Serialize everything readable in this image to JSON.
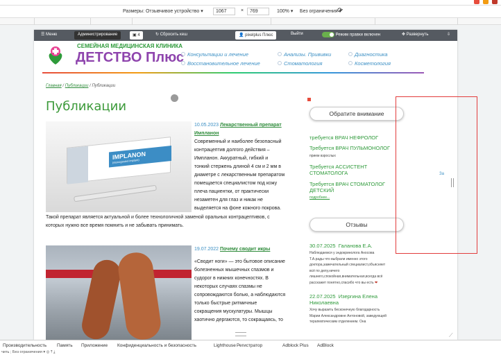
{
  "devtools_bar": {
    "dimensions_label": "Размеры: Отзывчивое устройство ▾",
    "width": "1067",
    "times": "×",
    "height": "769",
    "zoom": "100% ▾",
    "throttling": "Без ограничения ▾"
  },
  "admin_bar": {
    "menu": "Меню",
    "admin": "Администрирование",
    "badge": "4",
    "reset_cache": "Сбросить кеш",
    "user": "pixelplus Плюс",
    "logout": "Выйти",
    "edit_mode": "Режим правки включен",
    "expand": "Развернуть"
  },
  "site": {
    "logo_line1": "СЕМЕЙНАЯ МЕДИЦИНСКАЯ КЛИНИКА",
    "logo_line2": "ДЕТСТВО Плюс",
    "nav": [
      "Консультации и лечение",
      "Анализы. Прививки",
      "Диагностика",
      "Восстановительное лечение",
      "Стоматология",
      "Косметология"
    ]
  },
  "breadcrumb": {
    "home": "Главная",
    "sep1": " / ",
    "section": "Публикации",
    "sep2": " / ",
    "current": "Публикации"
  },
  "page_title": "Публикации",
  "publications": [
    {
      "date": "10.05.2023",
      "title_a": "Лекарственный препарат",
      "title_b": "Импланон",
      "lines": [
        "Современный и наиболее безопасный",
        "контрацептив долгого действия –",
        "Импланон. Аккуратный, гибкий и",
        "тонкий стержень длиной 4 см и 2 мм в",
        "диаметре с лекарственным препаратом",
        "помещается специалистом под кожу",
        "плеча пациентки, от практически",
        "незаметен для глаз и никак не",
        "выделяется на фоне кожного покрова."
      ],
      "tail1": "Такой препарат является актуальной и более технологичной заменой оральных контрацептивов, с",
      "tail2": "которых нужно все время помнить и не забывать принимать.",
      "image_label": "IMPLANON",
      "image_sub": "(etonogestrel implant)"
    },
    {
      "date": "19.07.2022",
      "title": "Почему сводит икры",
      "lines": [
        "«Сводит ноги» — это бытовое описание",
        "болезненных мышечных спазмов и",
        "судорог в нижних конечностях. В",
        "некоторых случаях спазмы не",
        "сопровождаются болью, а наблюдаются",
        "только быстрые ритмичные",
        "сокращения мускулатуры. Мышцы",
        "хаотично дергаются, то сокращаясь, то"
      ]
    }
  ],
  "sidebar": {
    "attention_button": "Обратите внимание",
    "vacancies": [
      {
        "text": "требуется ВРАЧ НЕФРОЛОГ"
      },
      {
        "text": "Требуется ВРАЧ ПУЛЬМОНОЛОГ",
        "sub": "прием взрослых"
      },
      {
        "text": "Требуется АССИСТЕНТ",
        "text2": "СТОМАТОЛОГА"
      },
      {
        "text": "Требуется ВРАЧ СТОМАТОЛОГ",
        "text2": "ДЕТСКИЙ",
        "more": "подробнее..."
      }
    ],
    "reviews_button": "Отзывы",
    "reviews": [
      {
        "date": "30.07.2025",
        "author": "Галанова Е.А.",
        "lines": [
          "Наблюдаемся у эндокринолога Аносова",
          "Т.А.рады что выбрали именно этого",
          "доктора,замечательный специалист,объясняет",
          "всё по делу,ничего",
          "лишнего,спокойная,внимательная,всегда всё",
          "расскажет понятно,спасибо что вы есть"
        ]
      },
      {
        "date": "22.07.2025",
        "author": "Изергина Елена",
        "author2": "Николаевна",
        "lines": [
          "Хочу выразить бесконечную благодарность",
          "Марии Александровне Антоновой, заведующей",
          "терапевтическим отделением. Она"
        ]
      }
    ]
  },
  "side_edge_text": "За",
  "devtools_panel": {
    "tabs": [
      "Производительность",
      "Память",
      "Приложение",
      "Конфиденциальность и безопасность",
      "Lighthouse",
      "Регистратор",
      "Adblock Plus",
      "AdBlock"
    ],
    "status": "чить ; Без ограничения ▾"
  },
  "colors": {
    "green": "#3c9a3a",
    "blue": "#3b8fc4",
    "purple": "#8e44ad",
    "highlight": "#e23b3b"
  }
}
